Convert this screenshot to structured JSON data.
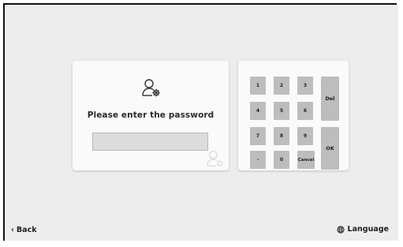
{
  "password_panel": {
    "prompt": "Please enter the password",
    "input_value": ""
  },
  "keypad": {
    "keys": [
      "1",
      "2",
      "3",
      "4",
      "5",
      "6",
      "7",
      "8",
      "9",
      "-",
      "0",
      "Cancel"
    ],
    "del_label": "Del",
    "ok_label": "OK"
  },
  "footer": {
    "back_label": "Back",
    "back_icon": "chevron-left",
    "language_label": "Language",
    "language_icon": "globe"
  },
  "colors": {
    "background": "#ededed",
    "card": "#fafafa",
    "key": "#bdbdbd",
    "input": "#dcdcdc"
  }
}
